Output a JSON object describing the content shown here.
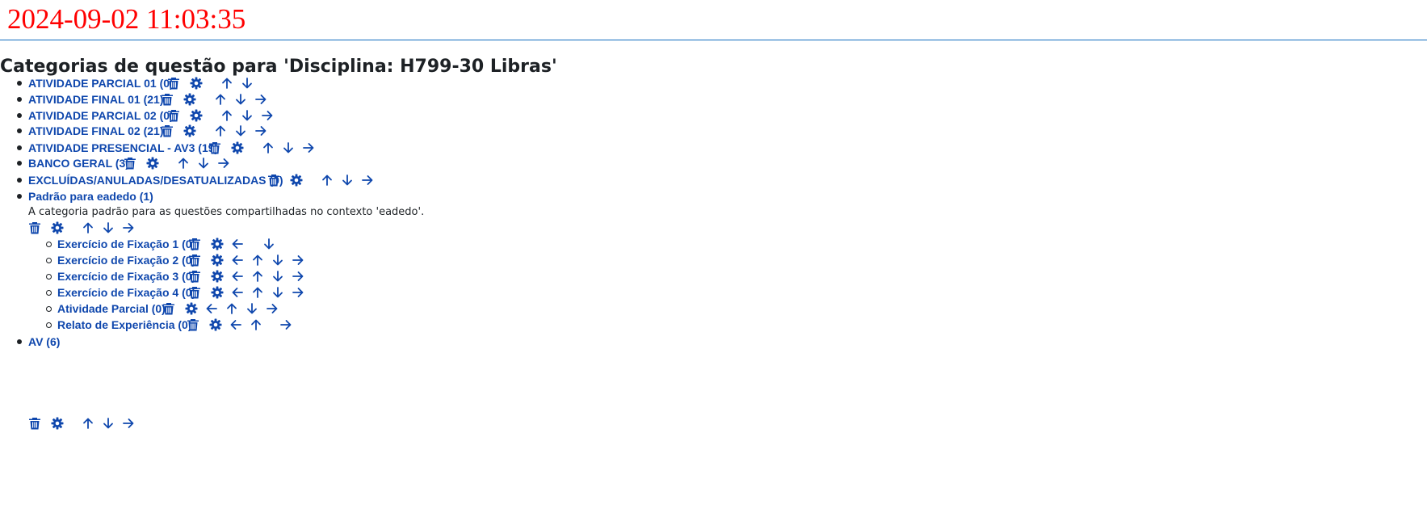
{
  "timestamp": "2024-09-02 11:03:35",
  "page_title": "Categorias de questão para 'Disciplina: H799-30 Libras'",
  "icons": {
    "delete": "trash-icon",
    "edit": "gear-icon",
    "move_left": "arrow-left-icon",
    "move_up": "arrow-up-icon",
    "move_down": "arrow-down-icon",
    "move_right": "arrow-right-icon"
  },
  "colors": {
    "link": "#0f47ad",
    "timestamp": "#ff0000",
    "rule": "#0f6cbf",
    "text": "#1d2125"
  },
  "categories": [
    {
      "label": "ATIVIDADE PARCIAL 01 (0)",
      "actions": [
        "delete",
        "edit",
        "move_up",
        "move_down"
      ]
    },
    {
      "label": "ATIVIDADE FINAL 01 (21)",
      "actions": [
        "delete",
        "edit",
        "move_up",
        "move_down",
        "move_right"
      ]
    },
    {
      "label": "ATIVIDADE PARCIAL 02 (0)",
      "actions": [
        "delete",
        "edit",
        "move_up",
        "move_down",
        "move_right"
      ]
    },
    {
      "label": "ATIVIDADE FINAL 02 (21)",
      "actions": [
        "delete",
        "edit",
        "move_up",
        "move_down",
        "move_right"
      ]
    },
    {
      "label": "ATIVIDADE PRESENCIAL - AV3 (19)",
      "actions": [
        "delete",
        "edit",
        "move_up",
        "move_down",
        "move_right"
      ]
    },
    {
      "label": "BANCO GERAL (3)",
      "actions": [
        "delete",
        "edit",
        "move_up",
        "move_down",
        "move_right"
      ]
    },
    {
      "label": "EXCLUÍDAS/ANULADAS/DESATUALIZADAS (0)",
      "actions": [
        "delete",
        "edit",
        "move_up",
        "move_down",
        "move_right"
      ]
    },
    {
      "label": "Padrão para eadedo (1)",
      "description": "A categoria padrão para as questões compartilhadas no contexto 'eadedo'.",
      "actions": [
        "delete",
        "edit",
        "move_up",
        "move_down",
        "move_right"
      ],
      "children": [
        {
          "label": "Exercício de Fixação 1 (0)",
          "actions": [
            "delete",
            "edit",
            "move_left",
            "move_down"
          ]
        },
        {
          "label": "Exercício de Fixação 2 (0)",
          "actions": [
            "delete",
            "edit",
            "move_left",
            "move_up",
            "move_down",
            "move_right"
          ]
        },
        {
          "label": "Exercício de Fixação 3 (0)",
          "actions": [
            "delete",
            "edit",
            "move_left",
            "move_up",
            "move_down",
            "move_right"
          ]
        },
        {
          "label": "Exercício de Fixação 4 (0)",
          "actions": [
            "delete",
            "edit",
            "move_left",
            "move_up",
            "move_down",
            "move_right"
          ]
        },
        {
          "label": "Atividade Parcial (0)",
          "actions": [
            "delete",
            "edit",
            "move_left",
            "move_up",
            "move_down",
            "move_right"
          ]
        },
        {
          "label": "Relato de Experiência (0)",
          "actions": [
            "delete",
            "edit",
            "move_left",
            "move_up",
            "move_right"
          ]
        }
      ]
    },
    {
      "label": "AV (6)",
      "actions": [
        "delete",
        "edit",
        "move_up",
        "move_down",
        "move_right"
      ]
    }
  ]
}
